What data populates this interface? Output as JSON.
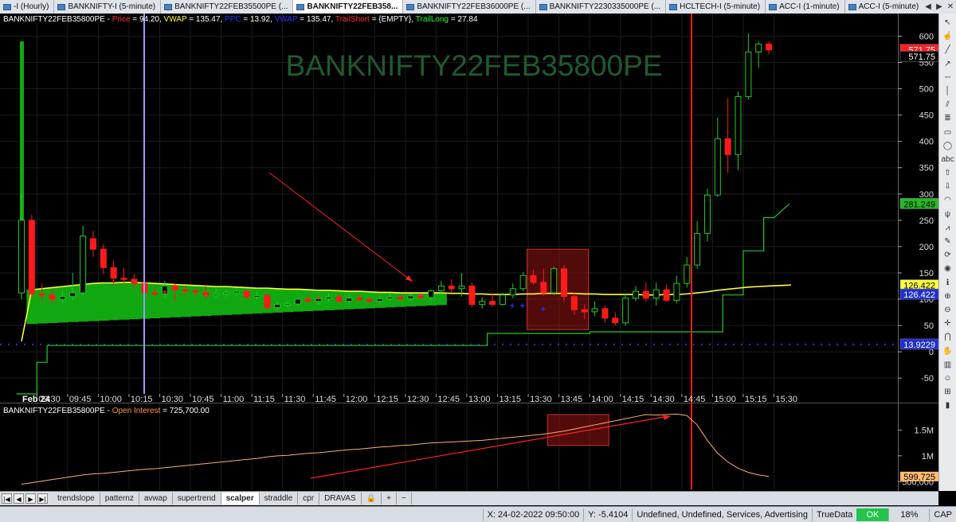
{
  "tabs": [
    {
      "label": "-I (Hourly)",
      "active": false
    },
    {
      "label": "BANKNIFTY-I (5-minute)",
      "active": false
    },
    {
      "label": "BANKNIFTY22FEB35500PE (...",
      "active": false
    },
    {
      "label": "BANKNIFTY22FEB358...",
      "active": true
    },
    {
      "label": "BANKNIFTY22FEB36000PE (...",
      "active": false
    },
    {
      "label": "BANKNIFTY2230335000PE (...",
      "active": false
    },
    {
      "label": "HCLTECH-I (5-minute)",
      "active": false
    },
    {
      "label": "ACC-I (1-minute)",
      "active": false
    },
    {
      "label": "ACC-I (5-minute)",
      "active": false
    }
  ],
  "main_pane": {
    "symbol": "BANKNIFTY22FEB35800PE",
    "legend": [
      {
        "label": "Price",
        "value": "94.20",
        "color": "#ff3030"
      },
      {
        "label": "VWAP",
        "value": "135.47",
        "color": "#ffff30"
      },
      {
        "label": "PPC",
        "value": "13.92",
        "color": "#3030ff"
      },
      {
        "label": "VWAP",
        "value": "135.47",
        "color": "#3030ff"
      },
      {
        "label": "TrailShort",
        "value": "{EMPTY}",
        "color": "#ff3030"
      },
      {
        "label": "TrailLong",
        "value": "27.84",
        "color": "#30ff30"
      }
    ],
    "watermark": "BANKNIFTY22FEB35800PE",
    "y_ticks": [
      "600",
      "550",
      "500",
      "450",
      "400",
      "350",
      "300",
      "250",
      "200",
      "150",
      "100",
      "50",
      "0",
      "-50"
    ],
    "price_tags": [
      {
        "text": "571.75",
        "bg": "#ff2020",
        "fg": "#ffffff",
        "value": 574
      },
      {
        "text": "571.75",
        "bg": "#000000",
        "fg": "#ffffff",
        "value": 561
      },
      {
        "text": "281.249",
        "bg": "#22bb22",
        "fg": "#000000",
        "value": 281
      },
      {
        "text": "126.422",
        "bg": "#ffff40",
        "fg": "#000000",
        "value": 126.4
      },
      {
        "text": "126.422",
        "bg": "#2030d0",
        "fg": "#ffffff",
        "value": 109
      },
      {
        "text": "13.9229",
        "bg": "#2030d0",
        "fg": "#ffffff",
        "value": 13.9
      }
    ],
    "x_date": "Feb 24",
    "x_ticks": [
      "09:30",
      "09:45",
      "10:00",
      "10:15",
      "10:30",
      "10:45",
      "11:00",
      "11:15",
      "11:30",
      "11:45",
      "12:00",
      "12:15",
      "12:30",
      "12:45",
      "13:00",
      "13:15",
      "13:30",
      "13:45",
      "14:00",
      "14:15",
      "14:30",
      "14:45",
      "15:00",
      "15:15",
      "15:30"
    ]
  },
  "oi_pane": {
    "symbol": "BANKNIFTY22FEB35800PE",
    "label": "Open Interest",
    "value": "725,700.00",
    "label_color": "#ff9a30",
    "y_ticks": [
      "1.5M",
      "1M",
      "500,000"
    ],
    "price_tag": {
      "text": "599,725",
      "bg": "#ffbb70",
      "fg": "#000000",
      "value": 599725
    }
  },
  "chart_data": {
    "type": "candlestick",
    "title": "BANKNIFTY22FEB35800PE",
    "xlabel": "",
    "ylabel": "",
    "ylim": [
      -80,
      640
    ],
    "x": [
      "09:20",
      "09:25",
      "09:30",
      "09:35",
      "09:40",
      "09:45",
      "09:50",
      "09:55",
      "10:00",
      "10:05",
      "10:10",
      "10:15",
      "10:20",
      "10:25",
      "10:30",
      "10:35",
      "10:40",
      "10:45",
      "10:50",
      "10:55",
      "11:00",
      "11:05",
      "11:10",
      "11:15",
      "11:20",
      "11:25",
      "11:30",
      "11:35",
      "11:40",
      "11:45",
      "11:50",
      "11:55",
      "12:00",
      "12:05",
      "12:10",
      "12:15",
      "12:20",
      "12:25",
      "12:30",
      "12:35",
      "12:40",
      "12:45",
      "12:50",
      "12:55",
      "13:00",
      "13:05",
      "13:10",
      "13:15",
      "13:20",
      "13:25",
      "13:30",
      "13:35",
      "13:40",
      "13:45",
      "13:50",
      "13:55",
      "14:00",
      "14:05",
      "14:10",
      "14:15",
      "14:20",
      "14:25",
      "14:30",
      "14:35",
      "14:40",
      "14:45",
      "14:50",
      "14:55",
      "15:00",
      "15:05",
      "15:10",
      "15:15",
      "15:20",
      "15:25"
    ],
    "candles": [
      [
        112,
        300,
        100,
        250
      ],
      [
        250,
        260,
        100,
        110
      ],
      [
        110,
        130,
        95,
        108
      ],
      [
        108,
        120,
        90,
        100
      ],
      [
        100,
        115,
        92,
        105
      ],
      [
        105,
        150,
        98,
        112
      ],
      [
        112,
        240,
        105,
        220
      ],
      [
        215,
        230,
        180,
        195
      ],
      [
        195,
        205,
        148,
        160
      ],
      [
        160,
        175,
        125,
        140
      ],
      [
        140,
        160,
        130,
        138
      ],
      [
        138,
        148,
        120,
        130
      ],
      [
        130,
        145,
        100,
        112
      ],
      [
        112,
        122,
        104,
        110
      ],
      [
        110,
        135,
        102,
        125
      ],
      [
        125,
        130,
        95,
        118
      ],
      [
        118,
        125,
        105,
        116
      ],
      [
        116,
        120,
        108,
        113
      ],
      [
        113,
        125,
        100,
        108
      ],
      [
        108,
        120,
        103,
        110
      ],
      [
        110,
        118,
        104,
        112
      ],
      [
        112,
        120,
        106,
        115
      ],
      [
        115,
        118,
        100,
        104
      ],
      [
        104,
        115,
        98,
        107
      ],
      [
        107,
        112,
        80,
        84
      ],
      [
        84,
        95,
        79,
        90
      ],
      [
        90,
        96,
        84,
        91
      ],
      [
        91,
        104,
        88,
        100
      ],
      [
        100,
        108,
        94,
        96
      ],
      [
        96,
        104,
        90,
        101
      ],
      [
        101,
        112,
        95,
        104
      ],
      [
        104,
        110,
        98,
        96
      ],
      [
        96,
        110,
        90,
        102
      ],
      [
        102,
        110,
        96,
        99
      ],
      [
        99,
        105,
        92,
        96
      ],
      [
        96,
        106,
        92,
        101
      ],
      [
        101,
        112,
        97,
        104
      ],
      [
        104,
        110,
        98,
        101
      ],
      [
        101,
        110,
        96,
        106
      ],
      [
        106,
        110,
        100,
        103
      ],
      [
        103,
        118,
        98,
        116
      ],
      [
        116,
        135,
        108,
        125
      ],
      [
        125,
        138,
        112,
        120
      ],
      [
        120,
        150,
        105,
        125
      ],
      [
        125,
        132,
        85,
        90
      ],
      [
        90,
        104,
        82,
        96
      ],
      [
        96,
        110,
        86,
        90
      ],
      [
        90,
        112,
        88,
        108
      ],
      [
        108,
        130,
        102,
        120
      ],
      [
        120,
        152,
        115,
        145
      ],
      [
        145,
        156,
        128,
        132
      ],
      [
        132,
        158,
        106,
        112
      ],
      [
        112,
        162,
        108,
        158
      ],
      [
        158,
        165,
        95,
        105
      ],
      [
        105,
        112,
        70,
        80
      ],
      [
        80,
        90,
        62,
        76
      ],
      [
        76,
        96,
        68,
        82
      ],
      [
        82,
        88,
        55,
        64
      ],
      [
        64,
        75,
        50,
        55
      ],
      [
        55,
        110,
        50,
        102
      ],
      [
        102,
        125,
        96,
        115
      ],
      [
        115,
        132,
        95,
        102
      ],
      [
        102,
        132,
        88,
        118
      ],
      [
        118,
        128,
        95,
        98
      ],
      [
        98,
        145,
        92,
        130
      ],
      [
        130,
        180,
        122,
        165
      ],
      [
        165,
        248,
        158,
        225
      ],
      [
        225,
        310,
        210,
        298
      ],
      [
        298,
        445,
        295,
        405
      ],
      [
        405,
        482,
        340,
        375
      ],
      [
        375,
        495,
        345,
        485
      ],
      [
        485,
        605,
        480,
        570
      ],
      [
        570,
        590,
        540,
        585
      ],
      [
        585,
        590,
        565,
        574
      ]
    ],
    "series": [
      {
        "name": "VWAP",
        "values": [
          20,
          118,
          120,
          122,
          124,
          126,
          128,
          130,
          131,
          131,
          132,
          132,
          131,
          130,
          129,
          128,
          127,
          126,
          125,
          124,
          124,
          123,
          122,
          121,
          121,
          120,
          119,
          119,
          118,
          117,
          117,
          116,
          115,
          115,
          114,
          113,
          113,
          112,
          112,
          112,
          112,
          112,
          111,
          111,
          110,
          110,
          109,
          109,
          109,
          110,
          110,
          111,
          111,
          111,
          111,
          110,
          110,
          109,
          109,
          109,
          109,
          108,
          108,
          109,
          109,
          110,
          112,
          114,
          117,
          119,
          121,
          123,
          124,
          125
        ]
      },
      {
        "name": "TrailLong",
        "values": [
          -80,
          -80,
          -20,
          12,
          12,
          12,
          12,
          12,
          12,
          12,
          12,
          12,
          12,
          12,
          12,
          12,
          12,
          12,
          12,
          12,
          12,
          12,
          12,
          12,
          12,
          12,
          12,
          12,
          12,
          12,
          12,
          12,
          12,
          12,
          12,
          12,
          12,
          12,
          12,
          12,
          12,
          12,
          12,
          12,
          12,
          12,
          35,
          35,
          35,
          35,
          35,
          35,
          35,
          35,
          35,
          35,
          38,
          38,
          38,
          38,
          38,
          38,
          38,
          38,
          38,
          38,
          38,
          38,
          38,
          108,
          108,
          192,
          192,
          255
        ]
      },
      {
        "name": "PPC",
        "values": [
          13.9
        ]
      }
    ],
    "open_interest": {
      "ylim": [
        350000,
        2000000
      ],
      "values": [
        450000,
        480000,
        510000,
        540000,
        570000,
        600000,
        630000,
        650000,
        660000,
        680000,
        700000,
        720000,
        740000,
        750000,
        770000,
        790000,
        810000,
        830000,
        850000,
        870000,
        890000,
        910000,
        930000,
        950000,
        980000,
        1000000,
        1010000,
        1030000,
        1050000,
        1060000,
        1080000,
        1100000,
        1120000,
        1130000,
        1150000,
        1170000,
        1180000,
        1200000,
        1210000,
        1230000,
        1250000,
        1260000,
        1270000,
        1280000,
        1290000,
        1300000,
        1320000,
        1340000,
        1360000,
        1380000,
        1400000,
        1420000,
        1450000,
        1480000,
        1520000,
        1560000,
        1600000,
        1640000,
        1680000,
        1720000,
        1760000,
        1800000,
        1790000,
        1800000,
        1810000,
        1780000,
        1600000,
        1300000,
        1050000,
        880000,
        760000,
        680000,
        630000,
        600000
      ]
    }
  },
  "sheet_tabs": [
    "trendslope",
    "patternz",
    "avwap",
    "supertrend",
    "scalper",
    "straddle",
    "cpr",
    "DRAVAS"
  ],
  "active_sheet": "scalper",
  "status": {
    "coords_x": "X: 24-02-2022 09:50:00",
    "coords_y": "Y: -5.4104",
    "info": "Undefined, Undefined, Services, Advertising",
    "datasource": "TrueData",
    "ok": "OK",
    "cpu": "18%",
    "caps": "CAP"
  }
}
